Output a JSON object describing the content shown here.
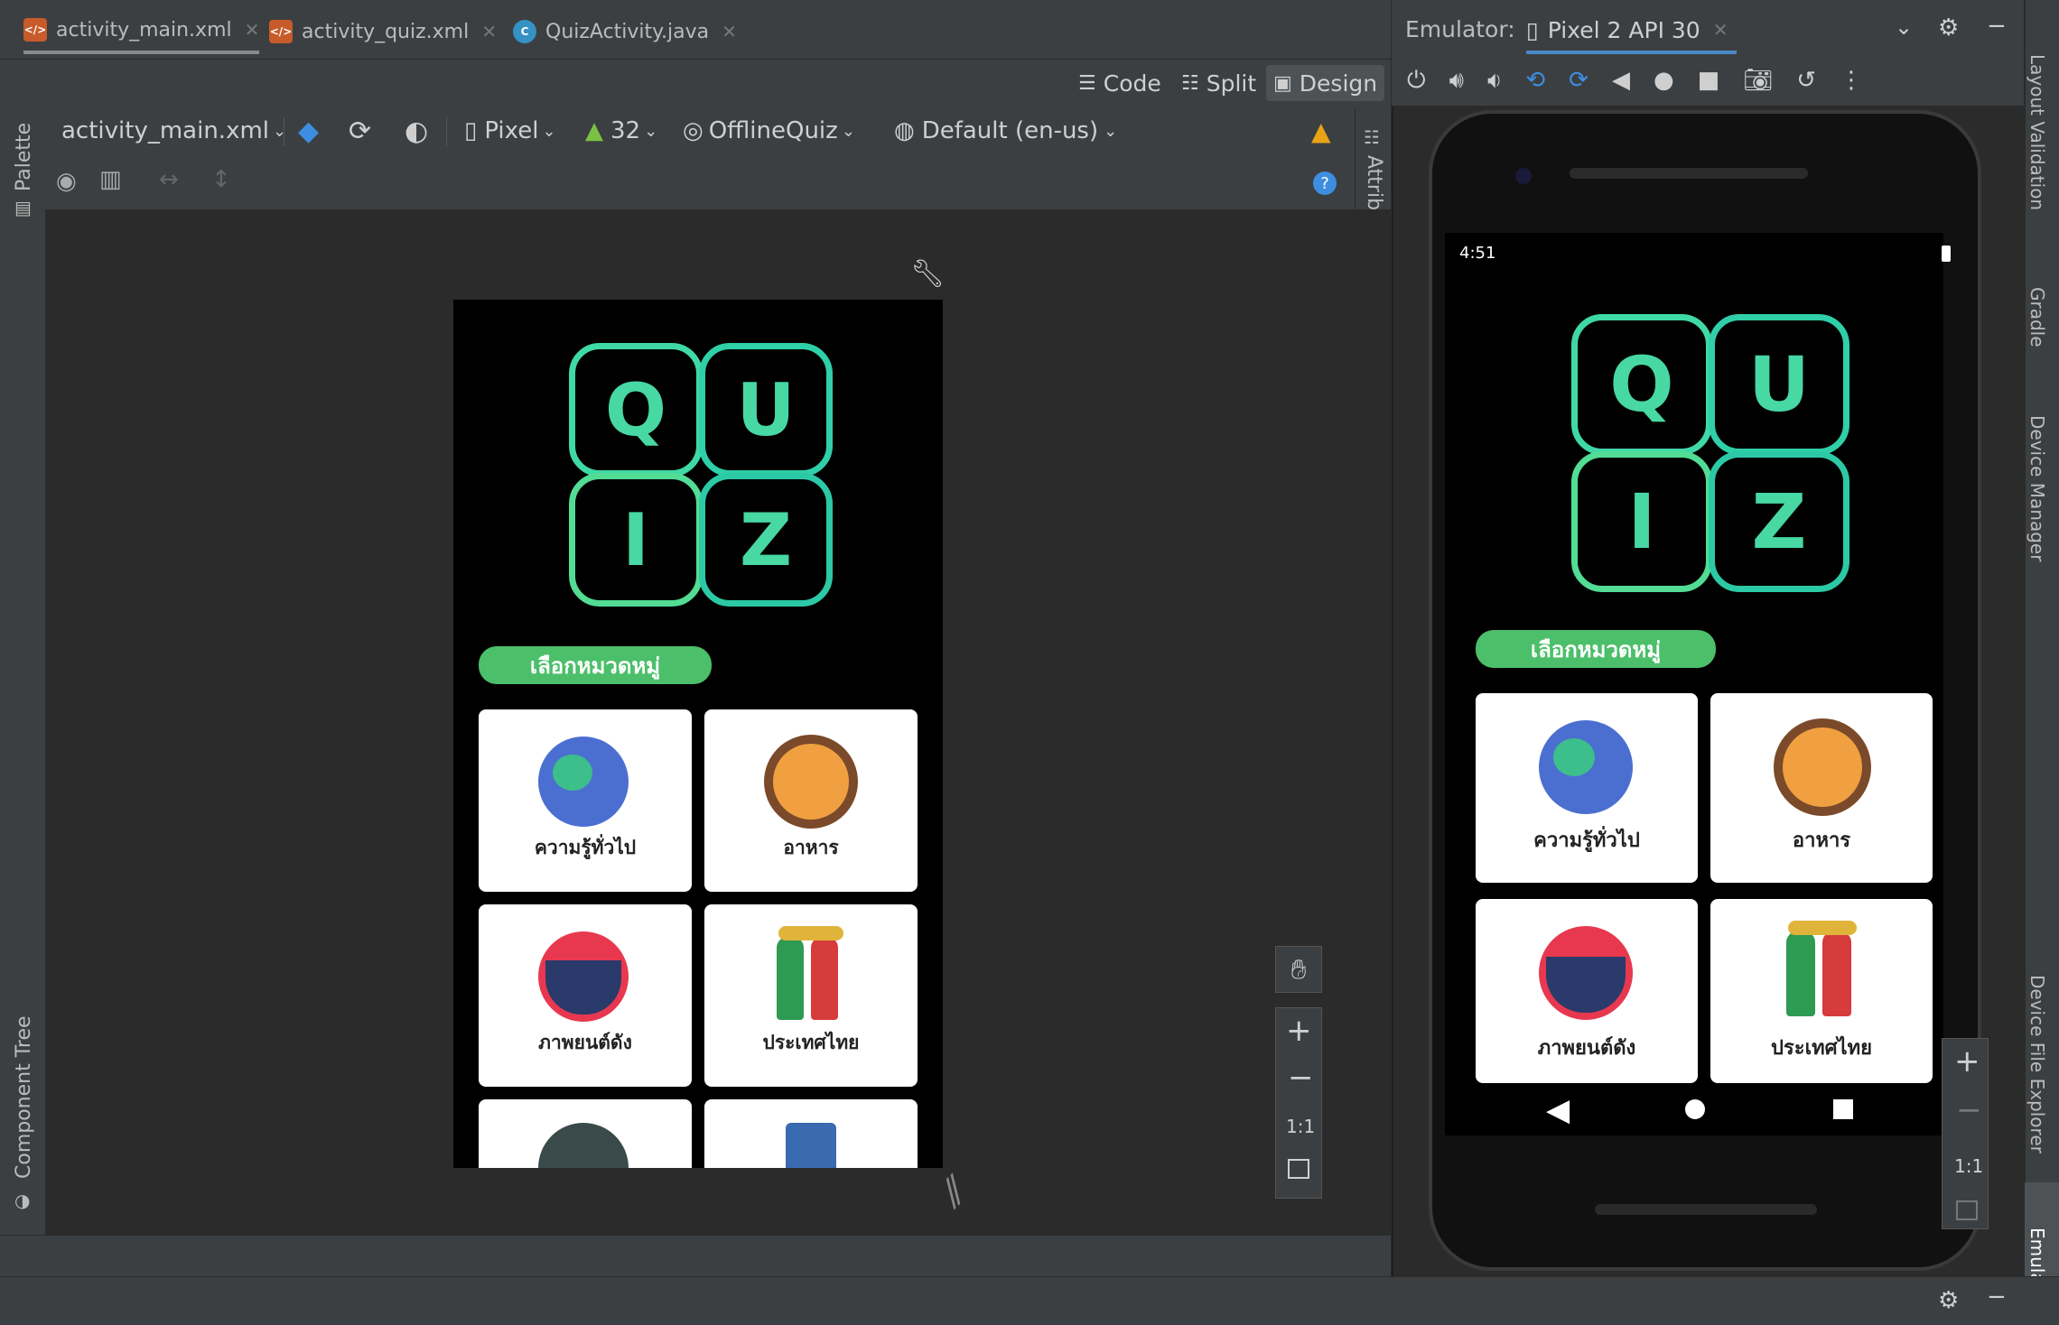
{
  "tabs": [
    {
      "label": "activity_main.xml",
      "active": true
    },
    {
      "label": "activity_quiz.xml",
      "active": false
    },
    {
      "label": "QuizActivity.java",
      "active": false
    }
  ],
  "modes": {
    "code": "Code",
    "split": "Split",
    "design": "Design"
  },
  "toolbar": {
    "file": "activity_main.xml",
    "device": "Pixel",
    "api": "32",
    "theme": "OfflineQuiz",
    "locale": "Default (en-us)"
  },
  "side": {
    "palette": "Palette",
    "component_tree": "Component Tree",
    "attributes": "Attributes"
  },
  "emulator": {
    "label": "Emulator:",
    "device_tab": "Pixel 2 API 30",
    "time": "4:51"
  },
  "right_tools": [
    "Layout Validation",
    "Gradle",
    "Device Manager",
    "Device File Explorer",
    "Emulator"
  ],
  "zoom": {
    "one_to_one": "1:1"
  },
  "app": {
    "logo_letters": [
      "Q",
      "U",
      "I",
      "Z"
    ],
    "category_button": "เลือกหมวดหมู่",
    "categories": [
      {
        "label": "ความรู้ทั่วไป",
        "icon": "globe-icon"
      },
      {
        "label": "อาหาร",
        "icon": "food-bowl-icon"
      },
      {
        "label": "ภาพยนต์ดัง",
        "icon": "movie-clapper-icon"
      },
      {
        "label": "ประเทศไทย",
        "icon": "thai-dancers-icon"
      }
    ]
  },
  "colors": {
    "accent_green": "#4cbf6a",
    "logo_teal": "#3fd9a7",
    "ide_bg": "#3c3f41",
    "canvas_bg": "#2b2b2b"
  }
}
